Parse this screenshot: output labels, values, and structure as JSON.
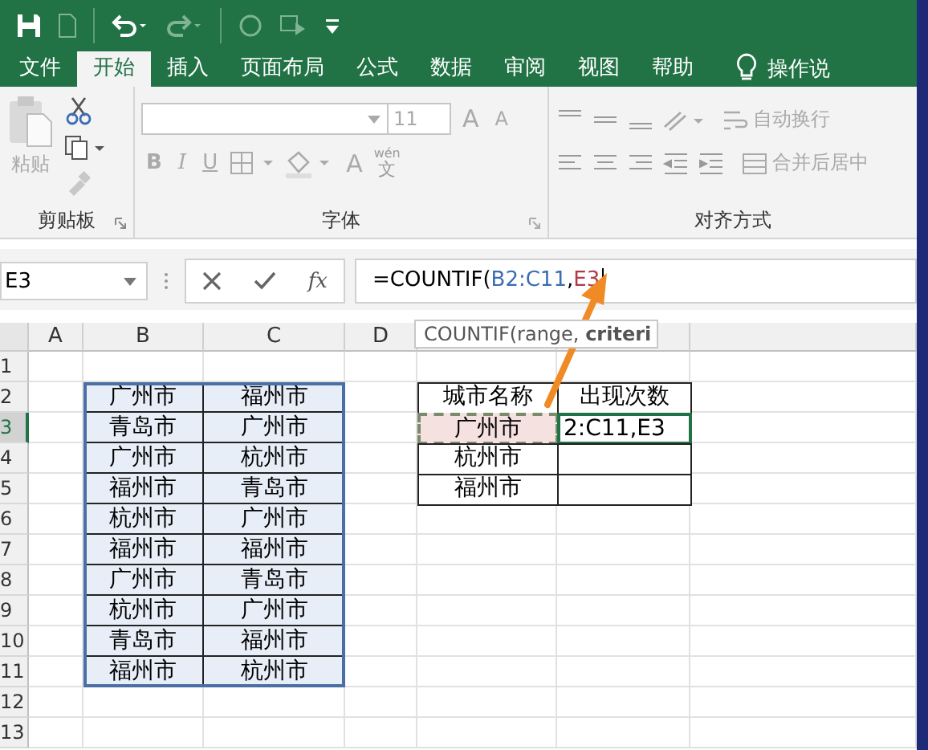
{
  "tabs": [
    {
      "label": "文件",
      "selected": false
    },
    {
      "label": "开始",
      "selected": true
    },
    {
      "label": "插入",
      "selected": false
    },
    {
      "label": "页面布局",
      "selected": false
    },
    {
      "label": "公式",
      "selected": false
    },
    {
      "label": "数据",
      "selected": false
    },
    {
      "label": "审阅",
      "selected": false
    },
    {
      "label": "视图",
      "selected": false
    },
    {
      "label": "帮助",
      "selected": false
    }
  ],
  "tell_me": "操作说",
  "ribbon": {
    "paste_label": "粘贴",
    "font_size": "11",
    "grow_font": "A",
    "shrink_font": "A",
    "bold": "B",
    "italic": "I",
    "underline": "U",
    "font_color": "A",
    "phonetic_top": "wén",
    "phonetic_bottom": "文",
    "wrap_text": "自动换行",
    "merge_center": "合并后居中",
    "groups": [
      "剪贴板",
      "字体",
      "对齐方式"
    ]
  },
  "formula_bar": {
    "name_box": "E3",
    "fx": "fx",
    "formula_start": "=COUNTIF(",
    "separator": ",",
    "references": [
      {
        "text": "B2:C11",
        "color": "#3b6cb4"
      },
      {
        "text": "E3",
        "color": "#b03a48"
      }
    ]
  },
  "tooltip": "COUNTIF(range, **criteri**",
  "sheet": {
    "columns": [
      {
        "label": "A",
        "selected": false
      },
      {
        "label": "B",
        "selected": false
      },
      {
        "label": "C",
        "selected": false
      },
      {
        "label": "D",
        "selected": false
      }
    ],
    "rows": [
      {
        "label": "1",
        "selected": false
      },
      {
        "label": "2",
        "selected": false
      },
      {
        "label": "3",
        "selected": true
      },
      {
        "label": "4",
        "selected": false
      },
      {
        "label": "5",
        "selected": false
      },
      {
        "label": "6",
        "selected": false
      },
      {
        "label": "7",
        "selected": false
      },
      {
        "label": "8",
        "selected": false
      },
      {
        "label": "9",
        "selected": false
      },
      {
        "label": "10",
        "selected": false
      },
      {
        "label": "11",
        "selected": false
      },
      {
        "label": "12",
        "selected": false
      },
      {
        "label": "13",
        "selected": false
      }
    ],
    "data_table": [
      [
        "广州市",
        "福州市"
      ],
      [
        "青岛市",
        "广州市"
      ],
      [
        "广州市",
        "杭州市"
      ],
      [
        "福州市",
        "青岛市"
      ],
      [
        "杭州市",
        "广州市"
      ],
      [
        "福州市",
        "福州市"
      ],
      [
        "广州市",
        "青岛市"
      ],
      [
        "杭州市",
        "广州市"
      ],
      [
        "青岛市",
        "福州市"
      ],
      [
        "福州市",
        "杭州市"
      ]
    ],
    "lookup_header": [
      "城市名称",
      "出现次数"
    ],
    "lookup_rows": [
      {
        "city": "广州市",
        "city_referenced": true,
        "count": "2:C11,E3",
        "count_editing": true
      },
      {
        "city": "杭州市",
        "city_referenced": false,
        "count_editing": false
      },
      {
        "city": "福州市",
        "city_referenced": false,
        "count_editing": false
      }
    ]
  }
}
